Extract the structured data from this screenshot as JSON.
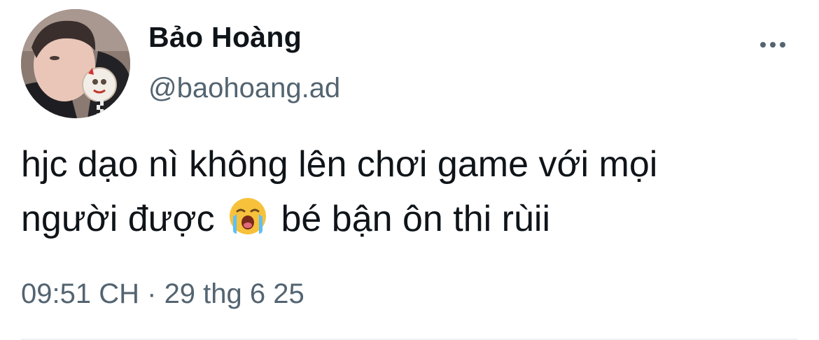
{
  "author": {
    "display_name": "Bảo Hoàng",
    "handle": "@baohoang.ad"
  },
  "tweet": {
    "line1": "hjc dạo nì không lên chơi game với mọi",
    "line2_before_emoji": "người được",
    "emoji": "loudly-crying-face",
    "line2_after_emoji": "bé bận ôn thi rùii"
  },
  "meta": {
    "time": "09:51 CH",
    "separator": "·",
    "date": "29 thg 6 25"
  },
  "colors": {
    "text_primary": "#0f1419",
    "text_secondary": "#536471",
    "divider": "#eff3f4"
  }
}
